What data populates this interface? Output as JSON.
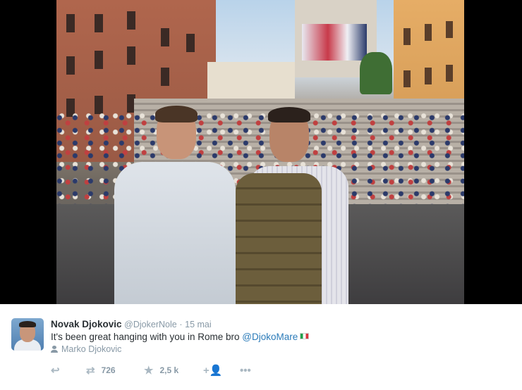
{
  "tweet": {
    "name": "Novak Djokovic",
    "handle": "@DjokerNole",
    "separator": "·",
    "date": "15 mai",
    "text_before": "It's been great hanging with you in Rome bro ",
    "mention": "@DjokoMare",
    "tagged_user": "Marko Djokovic"
  },
  "actions": {
    "reply_icon": "reply-icon",
    "retweet_icon": "retweet-icon",
    "retweet_count": "726",
    "favorite_icon": "star-icon",
    "favorite_count": "2,5 k",
    "follow_icon": "add-user-icon",
    "more_icon": "more-icon"
  },
  "colors": {
    "link": "#2b7bb9",
    "secondary_text": "#8899a6",
    "action_icon": "#aab8c2",
    "primary_text": "#292f33"
  }
}
